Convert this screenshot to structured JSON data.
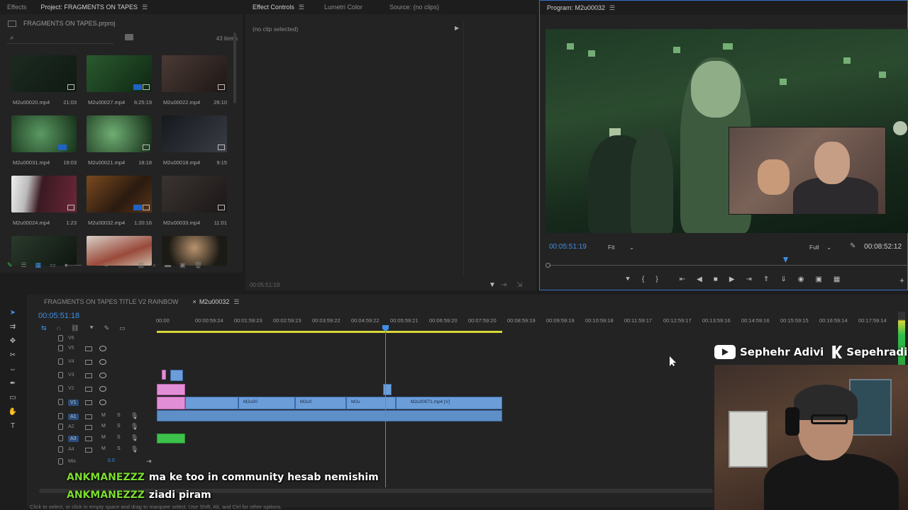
{
  "project_panel": {
    "tabs": [
      "Effects",
      "Project: FRAGMENTS ON TAPES"
    ],
    "path": "FRAGMENTS ON TAPES.prproj",
    "item_count": "43 items",
    "clips": [
      {
        "name": "M2u00020.mp4",
        "dur": "21:03"
      },
      {
        "name": "M2u00027.mp4",
        "dur": "6:25:19"
      },
      {
        "name": "M2u00022.mp4",
        "dur": "26:10"
      },
      {
        "name": "M2u00031.mp4",
        "dur": "19:03"
      },
      {
        "name": "M2u00021.mp4",
        "dur": "18:18"
      },
      {
        "name": "M2u00018.mp4",
        "dur": "9:15"
      },
      {
        "name": "M2u00024.mp4",
        "dur": "1:23"
      },
      {
        "name": "M2u00032.mp4",
        "dur": "1:20:16"
      },
      {
        "name": "M2u00033.mp4",
        "dur": "11:01"
      },
      {
        "name": "",
        "dur": ""
      },
      {
        "name": "",
        "dur": ""
      },
      {
        "name": "",
        "dur": ""
      }
    ]
  },
  "effect_controls": {
    "tabs": [
      "Effect Controls",
      "Lumetri Color",
      "Source: (no clips)"
    ],
    "empty_text": "(no clip selected)",
    "timecode": "00:05:51:19"
  },
  "program": {
    "title": "Program: M2u00032",
    "timecode": "00:05:51:19",
    "fit": "Fit",
    "quality": "Full",
    "duration": "00:08:52:12"
  },
  "timeline": {
    "tabs": [
      "FRAGMENTS ON TAPES TITLE V2 RAINBOW",
      "M2u00032"
    ],
    "timecode": "00:05:51:18",
    "ruler": [
      "00:00",
      "00:00:59:24",
      "00:01:59:23",
      "00:02:59:23",
      "00:03:59:22",
      "00:04:59:22",
      "00:05:59:21",
      "00:06:59:20",
      "00:07:59:20",
      "00:08:59:19",
      "00:09:59:19",
      "00:10:59:18",
      "00:11:59:17",
      "00:12:59:17",
      "00:13:59:16",
      "00:14:59:16",
      "00:15:59:15",
      "00:16:59:14",
      "00:17:59:14"
    ],
    "video_tracks": [
      "V6",
      "V5",
      "V4",
      "V3",
      "V2",
      "V1"
    ],
    "audio_tracks": [
      "A1",
      "A2",
      "A3",
      "A4"
    ],
    "mix_label": "Mix",
    "mix_value": "0.0",
    "clip_labels": [
      "M2u00",
      "M2u0",
      "M2u",
      "M2u00071.mp4 [V]"
    ],
    "m_label": "M",
    "s_label": "S"
  },
  "chat": [
    {
      "user": "ANKMANEZZZ",
      "msg": "ma ke too in community hesab nemishim"
    },
    {
      "user": "ANKMANEZZZ",
      "msg": "ziadi piram"
    }
  ],
  "social": {
    "youtube": "Sephehr Adivi",
    "kick": "Sepehradiv"
  },
  "status_bar": "Click to select, or click in empty space and drag to marquee select. Use Shift, Alt, and Ctrl for other options.",
  "colors": {
    "accent": "#3f8fe6",
    "chat_user": "#7ddc2e",
    "clip_video": "#6b9ed8",
    "clip_pink": "#e28ed6"
  }
}
